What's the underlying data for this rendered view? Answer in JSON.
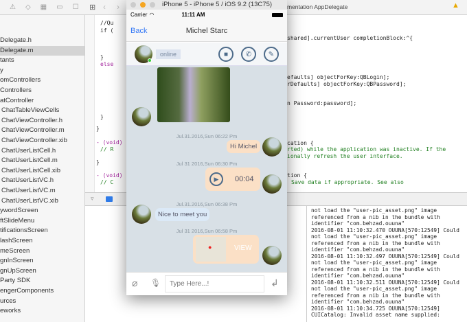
{
  "navigator": {
    "items": [
      "Delegate.h",
      "Delegate.m",
      "tants",
      "y",
      "omControllers",
      "Controllers",
      "atController",
      "ChatTableViewCells",
      "ChatViewController.h",
      "ChatViewController.m",
      "ChatViewController.xib",
      "ChatUserListCell.h",
      "ChatUserListCell.m",
      "ChatUserListCell.xib",
      "ChatUserListVC.h",
      "ChatUserListVC.m",
      "ChatUserListVC.xib",
      "ywordScreen",
      "ftSlideMenu",
      "tificationsScreen",
      "lashScreen",
      "meScreen",
      "gnInScreen",
      "gnUpScreen",
      "Party SDK",
      "engerComponents",
      "urces",
      "eworks"
    ],
    "selected_index": 1
  },
  "editor": {
    "breadcrumb": "mentation AppDelegate",
    "left_code": [
      "//Qu",
      "if (",
      "}",
      "else",
      "}",
      "}",
      "- (void)",
      "// R",
      "}",
      "- (void)",
      "// C"
    ],
    "right_code": [
      "shared].currentUser completionBlock:^{",
      "efaults] objectForKey:QBLogin];",
      "rDefaults] objectForKey:QBPassword];",
      "n Password:password];",
      "cation {",
      "rted) while the application was inactive. If the",
      "ionally refresh the user interface.",
      "tion {",
      "Save data if appropriate. See also"
    ]
  },
  "console": {
    "text": "not load the \"user-pic_asset.png\" image\nreferenced from a nib in the bundle with\nidentifier \"com.behzad.ouuna\"\n2016-08-01 11:10:32.470 OUUNA[570:12549] Could\nnot load the \"user-pic_asset.png\" image\nreferenced from a nib in the bundle with\nidentifier \"com.behzad.ouuna\"\n2016-08-01 11:10:32.497 OUUNA[570:12549] Could\nnot load the \"user-pic_asset.png\" image\nreferenced from a nib in the bundle with\nidentifier \"com.behzad.ouuna\"\n2016-08-01 11:10:32.511 OUUNA[570:12549] Could\nnot load the \"user-pic_asset.png\" image\nreferenced from a nib in the bundle with\nidentifier \"com.behzad.ouuna\"\n2016-08-01 11:10:34.725 OUUNA[570:12549]\nCUICatalog: Invalid asset name supplied:"
  },
  "simulator": {
    "title": "iPhone 5 - iPhone 5 / iOS 9.2 (13C75)",
    "carrier": "Carrier",
    "time": "11:11 AM",
    "back": "Back",
    "contact": "Michel Starc",
    "presence": "online",
    "messages": {
      "ts1": "Jul.31.2016,Sun 06:22 Pm",
      "m1": "Hi Michel",
      "ts2": "Jul 31 2016,Sun 06:30 Pm",
      "audio_duration": "00:04",
      "ts3": "Jul.31.2016,Sun 06:38 Pm",
      "m3": "Nice to meet you",
      "ts4": "Jul 31 2016,Sun 06:58 Pm",
      "view": "VIEW"
    },
    "input_placeholder": "Type Here...!"
  },
  "colors": {
    "accent": "#3478f6",
    "bubble_out": "#fbe0c6",
    "bubble_in": "#dbe9f7",
    "icon": "#4d6b8a"
  }
}
